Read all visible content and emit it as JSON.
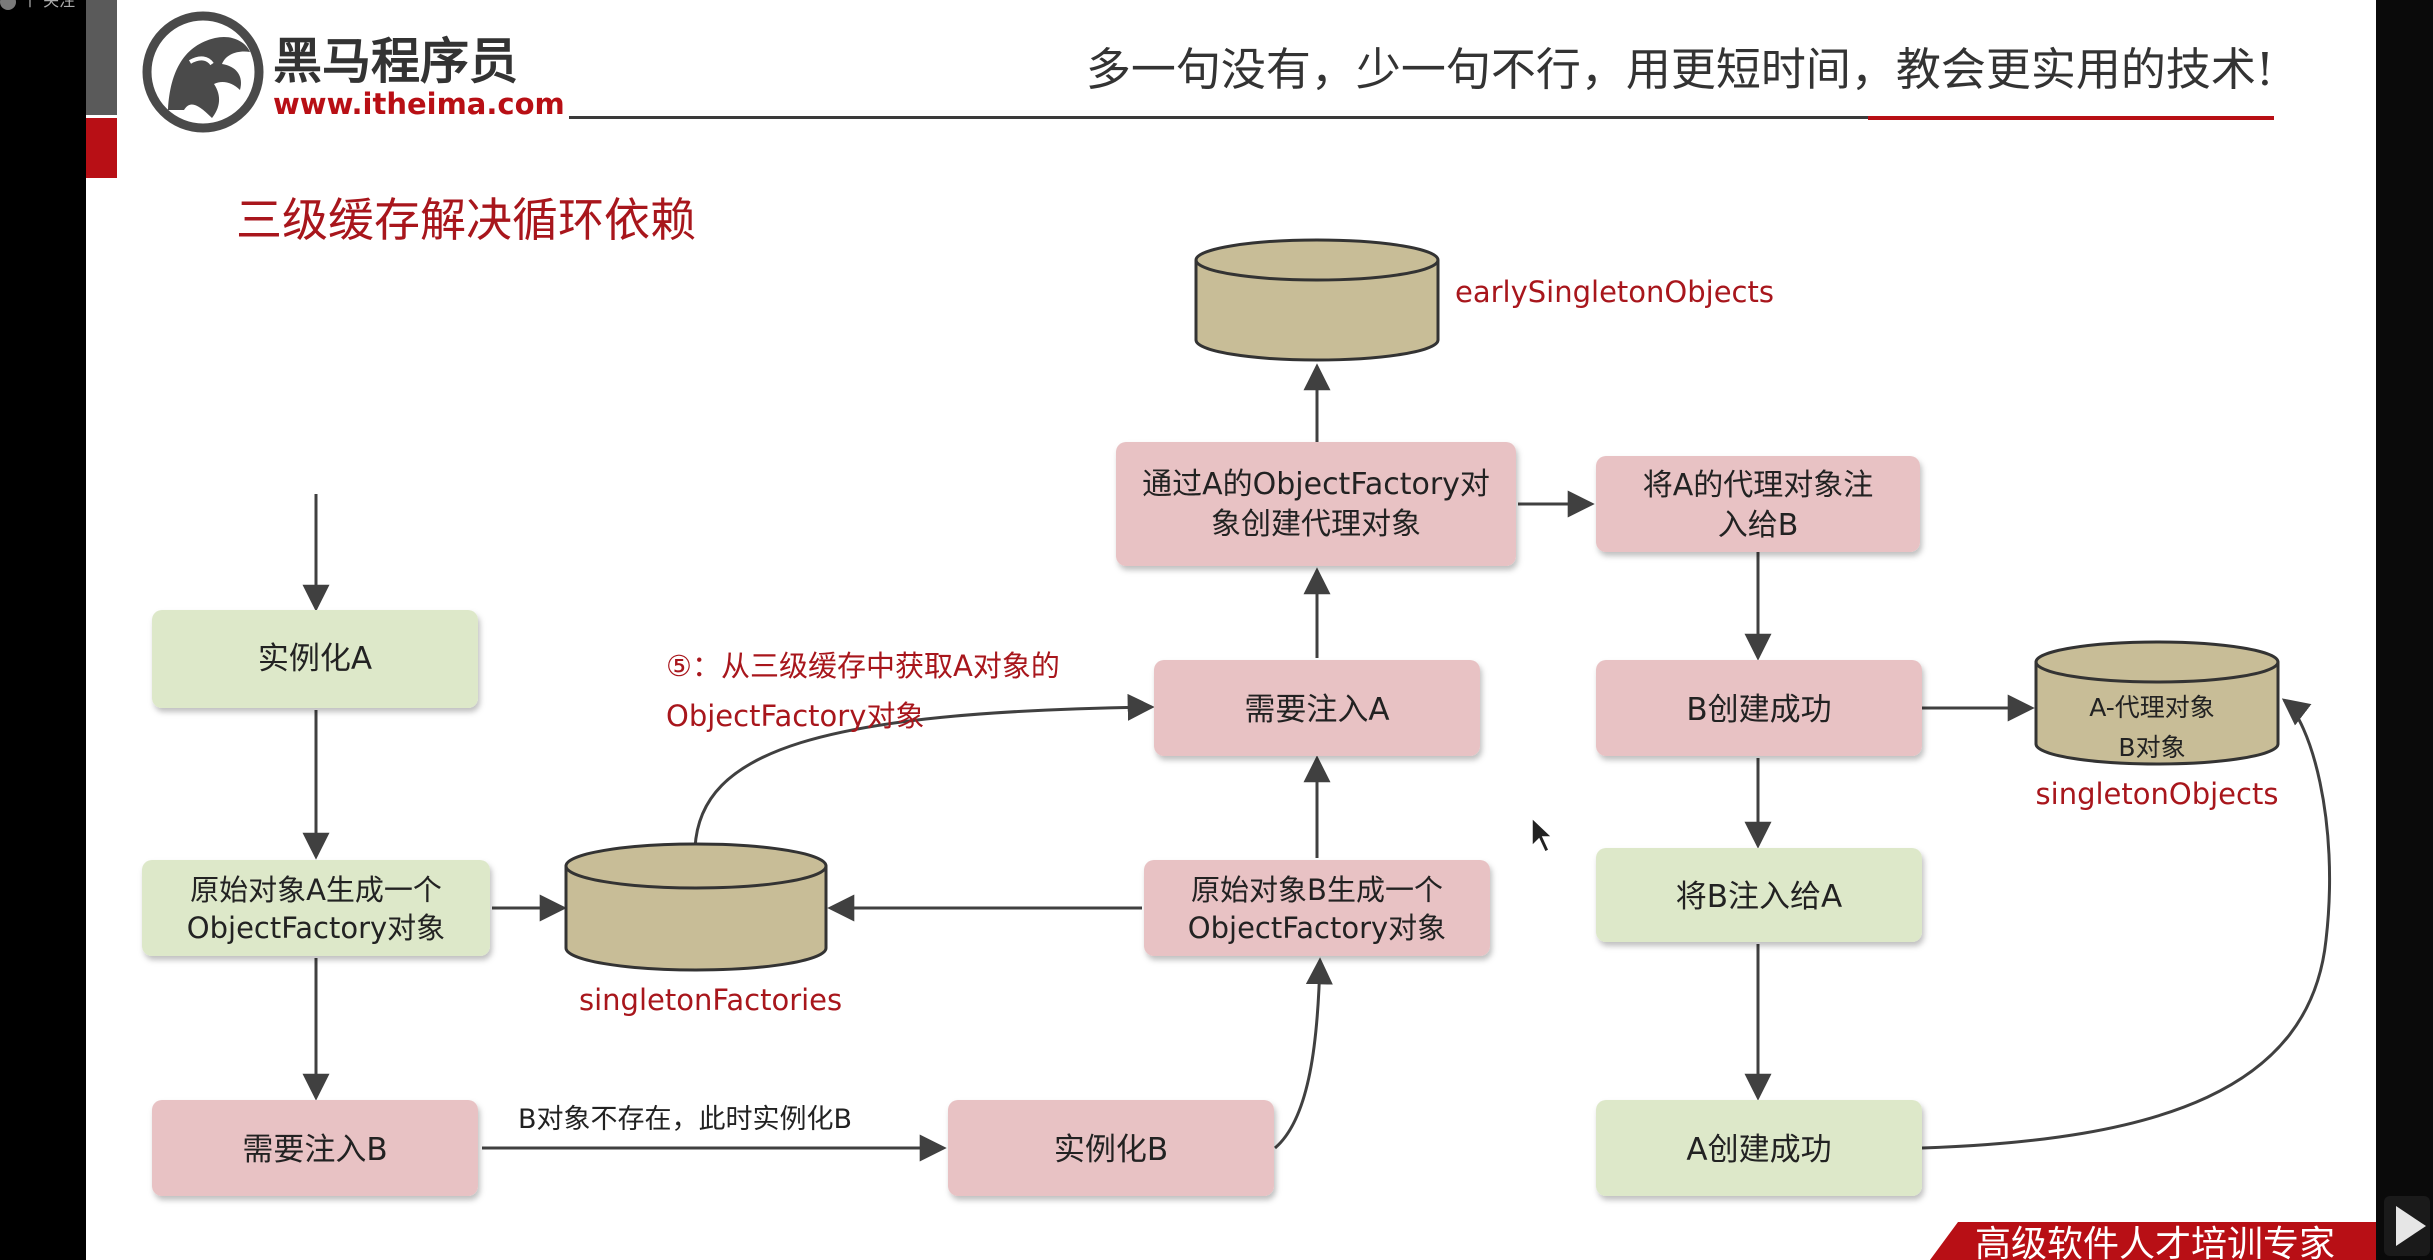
{
  "header": {
    "brand_name": "黑马程序员",
    "brand_url": "www.itheima.com",
    "slogan": "多一句没有，少一句不行，用更短时间，教会更实用的技术!",
    "corner_tag": "个  关注"
  },
  "slide": {
    "title": "三级缓存解决循环依赖",
    "footer_banner": "高级软件人才培训专家"
  },
  "diagram": {
    "boxes": {
      "instantiate_a": "实例化A",
      "factory_a_line1": "原始对象A生成一个",
      "factory_a_line2": "ObjectFactory对象",
      "inject_b": "需要注入B",
      "instantiate_b": "实例化B",
      "factory_b_line1": "原始对象B生成一个",
      "factory_b_line2": "ObjectFactory对象",
      "need_inject_a": "需要注入A",
      "proxy_line1": "通过A的ObjectFactory对",
      "proxy_line2": "象创建代理对象",
      "proxy_to_b_line1": "将A的代理对象注",
      "proxy_to_b_line2": "入给B",
      "b_created": "B创建成功",
      "inject_b_into_a": "将B注入给A",
      "a_created": "A创建成功"
    },
    "caches": {
      "early_label": "earlySingletonObjects",
      "factories_label": "singletonFactories",
      "singletons_label": "singletonObjects",
      "singletons_item1": "A-代理对象",
      "singletons_item2": "B对象"
    },
    "annotations": {
      "step5_line1": "⑤：从三级缓存中获取A对象的",
      "step5_line2": "ObjectFactory对象",
      "b_not_exist": "B对象不存在，此时实例化B"
    },
    "colors": {
      "green_box": "#dde8c9",
      "pink_box": "#e8c2c4",
      "cylinder": "#c8bd97",
      "accent_red": "#a8161c",
      "arrow": "#404040"
    }
  }
}
